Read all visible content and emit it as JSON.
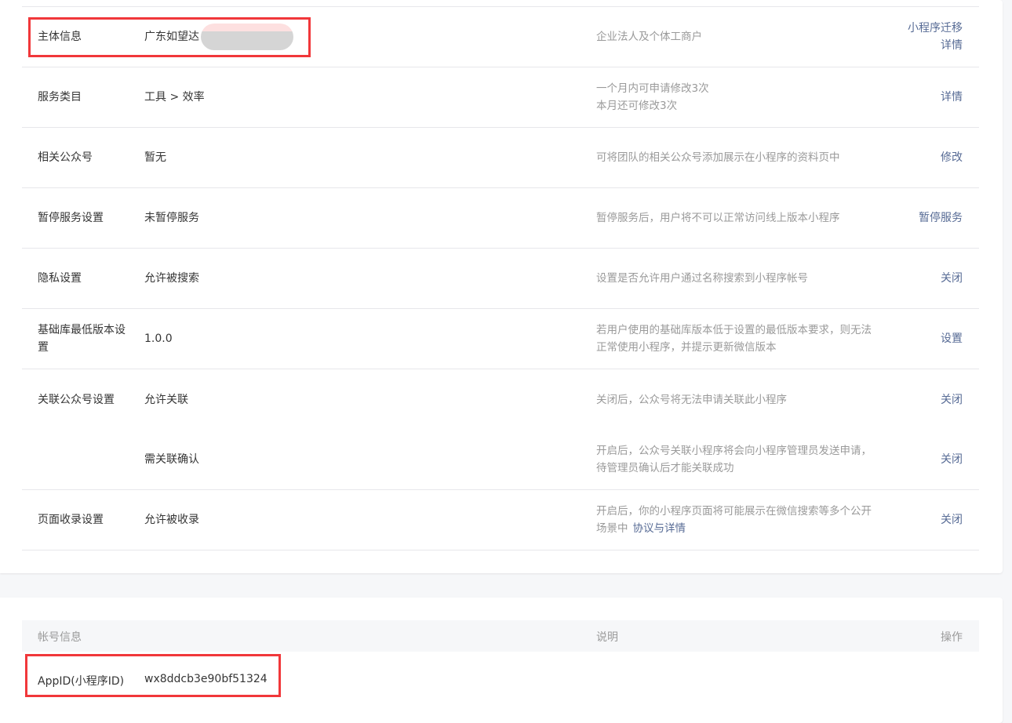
{
  "settings": [
    {
      "label": "主体信息",
      "value": "广东如望达",
      "desc": "企业法人及个体工商户",
      "actions": [
        "小程序迁移",
        "详情"
      ]
    },
    {
      "label": "服务类目",
      "value": "工具 > 效率",
      "desc": "一个月内可申请修改3次\n本月还可修改3次",
      "actions": [
        "详情"
      ]
    },
    {
      "label": "相关公众号",
      "value": "暂无",
      "desc": "可将团队的相关公众号添加展示在小程序的资料页中",
      "actions": [
        "修改"
      ]
    },
    {
      "label": "暂停服务设置",
      "value": "未暂停服务",
      "desc": "暂停服务后，用户将不可以正常访问线上版本小程序",
      "actions": [
        "暂停服务"
      ]
    },
    {
      "label": "隐私设置",
      "value": "允许被搜索",
      "desc": "设置是否允许用户通过名称搜索到小程序帐号",
      "actions": [
        "关闭"
      ]
    },
    {
      "label": "基础库最低版本设置",
      "value": "1.0.0",
      "desc": "若用户使用的基础库版本低于设置的最低版本要求，则无法正常使用小程序，并提示更新微信版本",
      "actions": [
        "设置"
      ]
    },
    {
      "label": "关联公众号设置",
      "value": "允许关联",
      "desc": "关闭后，公众号将无法申请关联此小程序",
      "actions": [
        "关闭"
      ]
    },
    {
      "label": "",
      "value": "需关联确认",
      "desc": "开启后，公众号关联小程序将会向小程序管理员发送申请，待管理员确认后才能关联成功",
      "actions": [
        "关闭"
      ]
    },
    {
      "label": "页面收录设置",
      "value": "允许被收录",
      "desc": "开启后，你的小程序页面将可能展示在微信搜索等多个公开场景中",
      "desc_link": "协议与详情",
      "actions": [
        "关闭"
      ]
    }
  ],
  "account": {
    "headers": [
      "帐号信息",
      "说明",
      "操作"
    ],
    "appid_label": "AppID(小程序ID)",
    "appid_value": "wx8ddcb3e90bf51324"
  }
}
